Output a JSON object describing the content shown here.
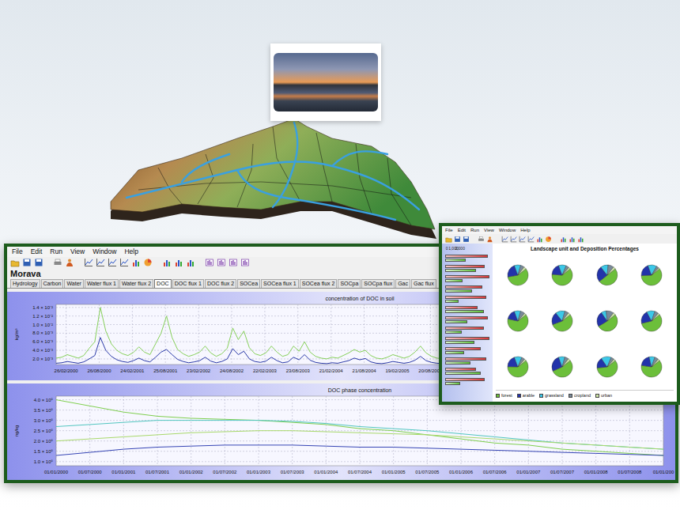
{
  "main_window": {
    "menu": [
      "File",
      "Edit",
      "Run",
      "View",
      "Window",
      "Help"
    ],
    "heading": "Morava",
    "tabs": [
      {
        "label": "Hydrology",
        "selected": false
      },
      {
        "label": "Carbon",
        "selected": false
      },
      {
        "label": "Water",
        "selected": false
      },
      {
        "label": "Water flux 1",
        "selected": false
      },
      {
        "label": "Water flux 2",
        "selected": false
      },
      {
        "label": "DOC",
        "selected": true
      },
      {
        "label": "DOC flux 1",
        "selected": false
      },
      {
        "label": "DOC flux 2",
        "selected": false
      },
      {
        "label": "SOCea",
        "selected": false
      },
      {
        "label": "SOCea flux 1",
        "selected": false
      },
      {
        "label": "SOCea flux 2",
        "selected": false
      },
      {
        "label": "SOCpa",
        "selected": false
      },
      {
        "label": "SOCpa flux",
        "selected": false
      },
      {
        "label": "Gac",
        "selected": false
      },
      {
        "label": "Gac flux",
        "selected": false
      }
    ],
    "charts": [
      {
        "title": "concentration of DOC in soil",
        "y_label": "kg/m³",
        "x_max": 110,
        "y_ticks": [
          {
            "label": "1.4 × 10⁻²",
            "value": 0.014
          },
          {
            "label": "1.2 × 10⁻²",
            "value": 0.012
          },
          {
            "label": "1.0 × 10⁻²",
            "value": 0.01
          },
          {
            "label": "8.0 × 10⁻³",
            "value": 0.008
          },
          {
            "label": "6.0 × 10⁻³",
            "value": 0.006
          },
          {
            "label": "4.0 × 10⁻³",
            "value": 0.004
          },
          {
            "label": "2.0 × 10⁻³",
            "value": 0.002
          }
        ],
        "x_ticks": [
          {
            "label": "26/02/2000",
            "at": 1.8
          },
          {
            "label": "26/08/2000",
            "at": 7.8
          },
          {
            "label": "24/02/2001",
            "at": 13.8
          },
          {
            "label": "25/08/2001",
            "at": 19.8
          },
          {
            "label": "23/02/2002",
            "at": 25.8
          },
          {
            "label": "24/08/2002",
            "at": 31.8
          },
          {
            "label": "22/02/2003",
            "at": 37.8
          },
          {
            "label": "23/08/2003",
            "at": 43.8
          },
          {
            "label": "21/02/2004",
            "at": 49.8
          },
          {
            "label": "21/08/2004",
            "at": 55.8
          },
          {
            "label": "19/02/2005",
            "at": 61.8
          },
          {
            "label": "20/08/2005",
            "at": 67.8
          }
        ],
        "series": [
          {
            "color": "#86d05a",
            "values": [
              0.0022,
              0.0024,
              0.003,
              0.0026,
              0.0022,
              0.0028,
              0.0045,
              0.006,
              0.014,
              0.0085,
              0.0055,
              0.004,
              0.0032,
              0.0028,
              0.0035,
              0.0048,
              0.0036,
              0.003,
              0.0055,
              0.008,
              0.012,
              0.007,
              0.0042,
              0.0032,
              0.0026,
              0.003,
              0.0036,
              0.005,
              0.0034,
              0.0026,
              0.0032,
              0.0045,
              0.0092,
              0.0065,
              0.0085,
              0.0046,
              0.0032,
              0.0028,
              0.0034,
              0.005,
              0.0036,
              0.0026,
              0.003,
              0.005,
              0.0038,
              0.006,
              0.0036,
              0.0026,
              0.0022,
              0.002,
              0.0024,
              0.0022,
              0.0028,
              0.0034,
              0.0042,
              0.0036,
              0.004,
              0.0028,
              0.0022,
              0.002,
              0.0024,
              0.003,
              0.0026,
              0.0022,
              0.0026,
              0.0036,
              0.005,
              0.0034,
              0.0026,
              0.0022,
              0.002,
              0.0024
            ]
          },
          {
            "color": "#2b3aa8",
            "values": [
              0.001,
              0.0011,
              0.0014,
              0.0012,
              0.001,
              0.0013,
              0.002,
              0.0028,
              0.007,
              0.004,
              0.0026,
              0.0018,
              0.0014,
              0.0012,
              0.0016,
              0.0022,
              0.0016,
              0.0013,
              0.0024,
              0.0036,
              0.0042,
              0.003,
              0.0019,
              0.0014,
              0.0011,
              0.0013,
              0.0016,
              0.0024,
              0.0015,
              0.0011,
              0.0014,
              0.002,
              0.0044,
              0.003,
              0.0038,
              0.002,
              0.0014,
              0.0012,
              0.0015,
              0.0024,
              0.0016,
              0.0011,
              0.0013,
              0.0024,
              0.0018,
              0.003,
              0.0017,
              0.0012,
              0.001,
              0.0009,
              0.0011,
              0.001,
              0.0013,
              0.0016,
              0.0022,
              0.0018,
              0.0021,
              0.0013,
              0.001,
              0.0009,
              0.0011,
              0.0014,
              0.0012,
              0.001,
              0.0012,
              0.0017,
              0.0026,
              0.0016,
              0.0012,
              0.001,
              0.0009,
              0.0011
            ]
          }
        ]
      },
      {
        "title": "DOC phase concentration",
        "y_label": "ng/kg",
        "x_max": 18,
        "y_ticks": [
          {
            "label": "4.0 × 10⁵",
            "value": 400000
          },
          {
            "label": "3.5 × 10⁵",
            "value": 350000
          },
          {
            "label": "3.0 × 10⁵",
            "value": 300000
          },
          {
            "label": "2.5 × 10⁵",
            "value": 250000
          },
          {
            "label": "2.0 × 10⁵",
            "value": 200000
          },
          {
            "label": "1.5 × 10⁵",
            "value": 150000
          },
          {
            "label": "1.0 × 10⁵",
            "value": 100000
          }
        ],
        "x_ticks": [
          {
            "label": "01/01/2000",
            "at": 0
          },
          {
            "label": "01/07/2000",
            "at": 1
          },
          {
            "label": "01/01/2001",
            "at": 2
          },
          {
            "label": "01/07/2001",
            "at": 3
          },
          {
            "label": "01/01/2002",
            "at": 4
          },
          {
            "label": "01/07/2002",
            "at": 5
          },
          {
            "label": "01/01/2003",
            "at": 6
          },
          {
            "label": "01/07/2003",
            "at": 7
          },
          {
            "label": "01/01/2004",
            "at": 8
          },
          {
            "label": "01/07/2004",
            "at": 9
          },
          {
            "label": "01/01/2005",
            "at": 10
          },
          {
            "label": "01/07/2005",
            "at": 11
          },
          {
            "label": "01/01/2006",
            "at": 12
          },
          {
            "label": "01/07/2006",
            "at": 13
          },
          {
            "label": "01/01/2007",
            "at": 14
          },
          {
            "label": "01/07/2007",
            "at": 15
          },
          {
            "label": "01/01/2008",
            "at": 16
          },
          {
            "label": "01/07/2008",
            "at": 17
          },
          {
            "label": "01/01/200",
            "at": 18
          }
        ],
        "series": [
          {
            "color": "#7fcf4f",
            "values": [
              400000,
              370000,
              340000,
              320000,
              310000,
              305000,
              300000,
              290000,
              280000,
              260000,
              250000,
              230000,
              210000,
              190000,
              180000,
              160000,
              150000,
              140000,
              130000
            ]
          },
          {
            "color": "#52c6c0",
            "values": [
              270000,
              280000,
              290000,
              300000,
              300000,
              300000,
              300000,
              295000,
              285000,
              270000,
              260000,
              250000,
              235000,
              220000,
              205000,
              190000,
              180000,
              170000,
              160000
            ]
          },
          {
            "color": "#a9d96b",
            "values": [
              200000,
              210000,
              220000,
              230000,
              240000,
              245000,
              250000,
              250000,
              245000,
              240000,
              235000,
              230000,
              220000,
              210000,
              200000,
              190000,
              180000,
              170000,
              160000
            ]
          },
          {
            "color": "#3645b5",
            "values": [
              130000,
              145000,
              160000,
              170000,
              175000,
              180000,
              180000,
              180000,
              175000,
              170000,
              170000,
              165000,
              160000,
              155000,
              150000,
              145000,
              140000,
              135000,
              130000
            ]
          }
        ]
      }
    ]
  },
  "second_window": {
    "menu": [
      "File",
      "Edit",
      "Run",
      "View",
      "Window",
      "Help"
    ],
    "bar_ticks": [
      {
        "label": "0",
        "value": 0
      },
      {
        "label": "1,000",
        "value": 1000
      },
      {
        "label": "2,000",
        "value": 2000
      }
    ],
    "bars": [
      {
        "red": 2900,
        "green": 1400
      },
      {
        "red": 2700,
        "green": 2100
      },
      {
        "red": 3000,
        "green": 1200
      },
      {
        "red": 2500,
        "green": 1800
      },
      {
        "red": 2800,
        "green": 900
      },
      {
        "red": 2200,
        "green": 2600
      },
      {
        "red": 2900,
        "green": 1500
      },
      {
        "red": 2600,
        "green": 1100
      },
      {
        "red": 3000,
        "green": 2000
      },
      {
        "red": 2400,
        "green": 1300
      },
      {
        "red": 2800,
        "green": 1700
      },
      {
        "red": 2100,
        "green": 2400
      },
      {
        "red": 2700,
        "green": 1000
      }
    ],
    "title": "Landscape unit and Deposition Percentages",
    "pies": [
      {
        "values": [
          58,
          22,
          10,
          6,
          4
        ]
      },
      {
        "values": [
          62,
          18,
          12,
          5,
          3
        ]
      },
      {
        "values": [
          50,
          25,
          12,
          9,
          4
        ]
      },
      {
        "values": [
          60,
          20,
          14,
          4,
          2
        ]
      },
      {
        "values": [
          64,
          16,
          10,
          7,
          3
        ]
      },
      {
        "values": [
          55,
          20,
          15,
          6,
          4
        ]
      },
      {
        "values": [
          52,
          24,
          8,
          12,
          4
        ]
      },
      {
        "values": [
          57,
          21,
          13,
          6,
          3
        ]
      },
      {
        "values": [
          61,
          19,
          12,
          5,
          3
        ]
      },
      {
        "values": [
          54,
          26,
          10,
          6,
          4
        ]
      },
      {
        "values": [
          59,
          17,
          16,
          5,
          3
        ]
      },
      {
        "values": [
          63,
          19,
          9,
          6,
          3
        ]
      }
    ],
    "legend": [
      {
        "label": "forest",
        "color": "#6cbf3a"
      },
      {
        "label": "arable",
        "color": "#2233aa"
      },
      {
        "label": "grassland",
        "color": "#3cc8e8"
      },
      {
        "label": "cropland",
        "color": "#7a8a9a"
      },
      {
        "label": "urban",
        "color": "#cde6a8"
      }
    ]
  }
}
